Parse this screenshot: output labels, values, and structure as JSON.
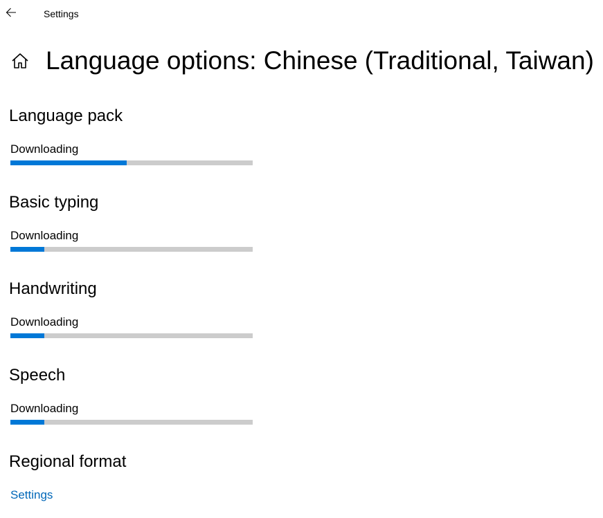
{
  "window": {
    "title": "Settings"
  },
  "header": {
    "title": "Language options: Chinese (Traditional, Taiwan)"
  },
  "sections": [
    {
      "title": "Language pack",
      "status": "Downloading",
      "progress": 0.48
    },
    {
      "title": "Basic typing",
      "status": "Downloading",
      "progress": 0.14
    },
    {
      "title": "Handwriting",
      "status": "Downloading",
      "progress": 0.14
    },
    {
      "title": "Speech",
      "status": "Downloading",
      "progress": 0.14
    }
  ],
  "regional": {
    "title": "Regional format",
    "link": "Settings"
  },
  "colors": {
    "accent": "#0078d7",
    "track": "#cccccc",
    "link": "#0067b8"
  },
  "icons": {
    "back": "back-arrow-icon",
    "home": "home-icon"
  }
}
